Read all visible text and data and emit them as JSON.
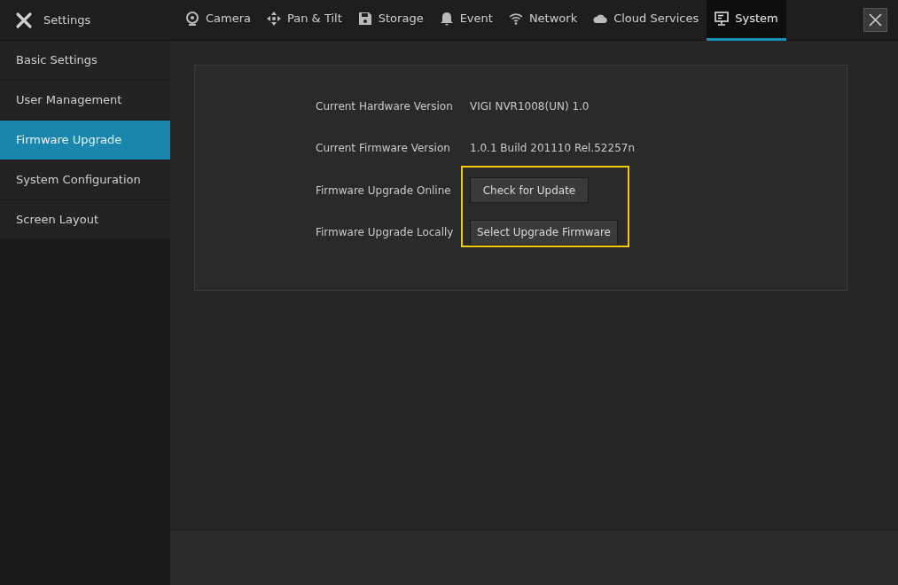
{
  "header": {
    "title": "Settings"
  },
  "tabs": [
    {
      "kind": "camera",
      "label": "Camera",
      "selected": false
    },
    {
      "kind": "pantilt",
      "label": "Pan & Tilt",
      "selected": false
    },
    {
      "kind": "storage",
      "label": "Storage",
      "selected": false
    },
    {
      "kind": "event",
      "label": "Event",
      "selected": false
    },
    {
      "kind": "network",
      "label": "Network",
      "selected": false
    },
    {
      "kind": "cloud",
      "label": "Cloud Services",
      "selected": false
    },
    {
      "kind": "system",
      "label": "System",
      "selected": true
    }
  ],
  "sidebar": {
    "items": [
      {
        "label": "Basic Settings",
        "selected": false
      },
      {
        "label": "User Management",
        "selected": false
      },
      {
        "label": "Firmware Upgrade",
        "selected": true
      },
      {
        "label": "System Configuration",
        "selected": false
      },
      {
        "label": "Screen Layout",
        "selected": false
      }
    ]
  },
  "panel": {
    "rows": [
      {
        "kind": "text",
        "label": "Current Hardware Version",
        "value": "VIGI NVR1008(UN) 1.0"
      },
      {
        "kind": "text",
        "label": "Current Firmware Version",
        "value": "1.0.1 Build 201110 Rel.52257n"
      },
      {
        "kind": "button",
        "label": "Firmware Upgrade Online",
        "value": "Check for Update"
      },
      {
        "kind": "button",
        "label": "Firmware Upgrade Locally",
        "value": "Select Upgrade Firmware"
      }
    ]
  }
}
